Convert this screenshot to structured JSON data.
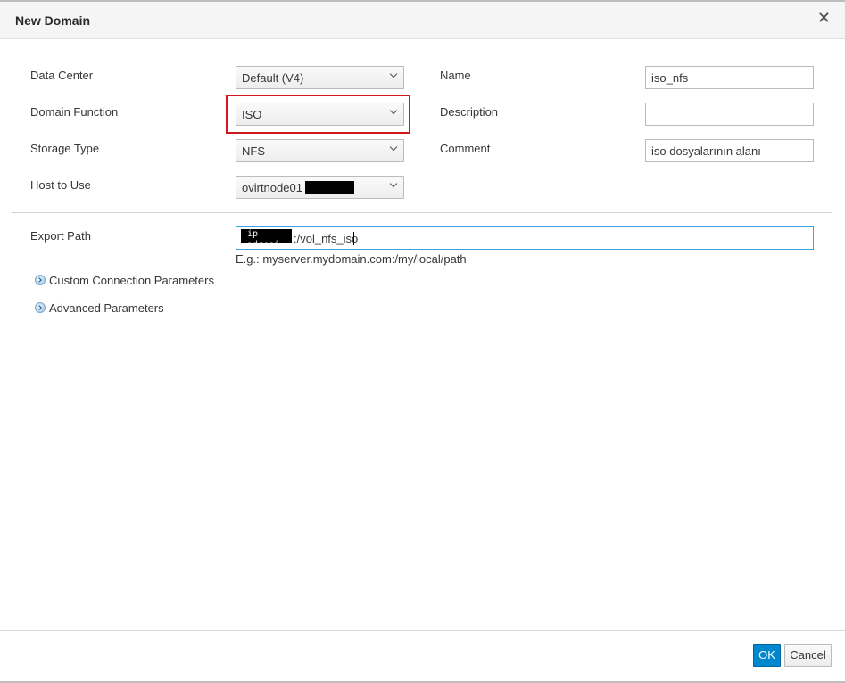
{
  "dialog": {
    "title": "New Domain",
    "close_symbol": "✕"
  },
  "form": {
    "data_center": {
      "label": "Data Center",
      "value": "Default (V4)"
    },
    "domain_function": {
      "label": "Domain Function",
      "value": "ISO"
    },
    "storage_type": {
      "label": "Storage Type",
      "value": "NFS"
    },
    "host_to_use": {
      "label": "Host to Use",
      "value": "ovirtnode01"
    },
    "name": {
      "label": "Name",
      "value": "iso_nfs"
    },
    "description": {
      "label": "Description",
      "value": ""
    },
    "comment": {
      "label": "Comment",
      "value": "iso dosyalarının alanı"
    }
  },
  "export": {
    "label": "Export Path",
    "redacted_overlay": "ip adresi",
    "path_value": ":/vol_nfs_iso",
    "hint": "E.g.: myserver.mydomain.com:/my/local/path"
  },
  "expanders": [
    {
      "label": "Custom Connection Parameters",
      "icon": "chevron-right-circle-icon"
    },
    {
      "label": "Advanced Parameters",
      "icon": "chevron-right-circle-icon"
    }
  ],
  "footer": {
    "ok_label": "OK",
    "cancel_label": "Cancel"
  },
  "colors": {
    "primary_button": "#0088ce",
    "highlight_box": "#d0191e",
    "focus_border": "#39a5dc"
  }
}
